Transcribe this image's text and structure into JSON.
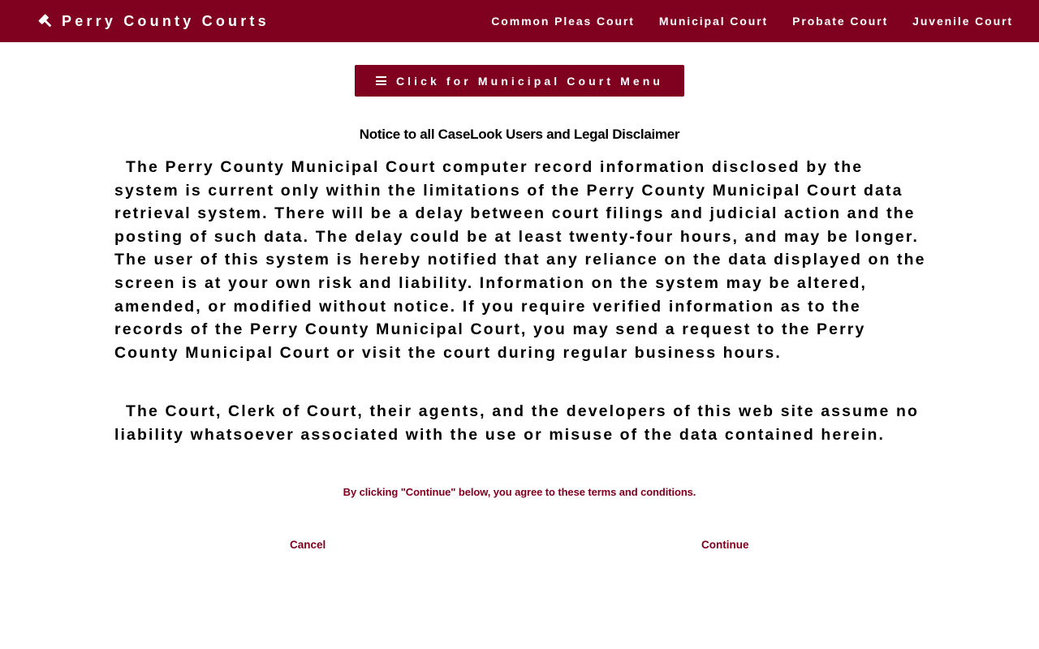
{
  "header": {
    "brand": "Perry County Courts",
    "brand_icon": "gavel-icon",
    "nav": [
      {
        "label": "Common Pleas Court"
      },
      {
        "label": "Municipal Court"
      },
      {
        "label": "Probate Court"
      },
      {
        "label": "Juvenile Court"
      }
    ]
  },
  "menu_button": {
    "label": "Click for Municipal Court Menu",
    "icon": "hamburger-icon"
  },
  "notice": {
    "title": "Notice to all CaseLook Users and Legal Disclaimer",
    "paragraphs": [
      "The Perry County Municipal Court computer record information disclosed by the system is current only within the limitations of the Perry County Municipal Court data retrieval system. There will be a delay between court filings and judicial action and the posting of such data. The delay could be at least twenty-four hours, and may be longer. The user of this system is hereby notified that any reliance on the data displayed on the screen is at your own risk and liability. Information on the system may be altered, amended, or modified without notice. If you require verified information as to the records of the Perry County Municipal Court, you may send a request to the Perry County Municipal Court or visit the court during regular business hours.",
      "The Court, Clerk of Court, their agents, and the developers of this web site assume no liability whatsoever associated with the use or misuse of the data contained herein."
    ],
    "agreement": "By clicking \"Continue\" below, you agree to these terms and conditions."
  },
  "actions": {
    "cancel_label": "Cancel",
    "continue_label": "Continue"
  },
  "colors": {
    "brand": "#800020",
    "text": "#000000",
    "background": "#ffffff"
  }
}
